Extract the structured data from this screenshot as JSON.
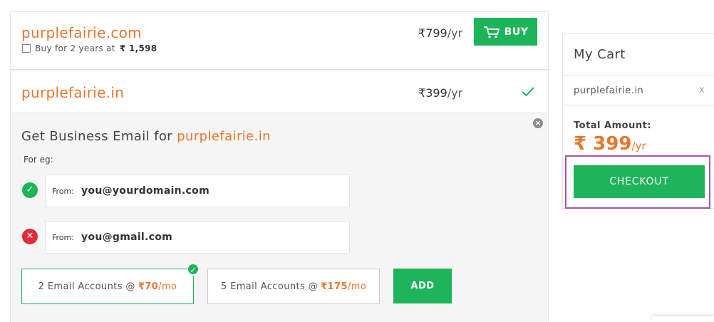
{
  "domains": [
    {
      "name": "purplefairie.com",
      "price_symbol": "₹",
      "price_value": "799",
      "price_unit": "/yr",
      "buy_label": "BUY",
      "option_text": "Buy for 2 years at",
      "option_price_symbol": "₹",
      "option_price": "1,598"
    },
    {
      "name": "purplefairie.in",
      "price_symbol": "₹",
      "price_value": "399",
      "price_unit": "/yr"
    }
  ],
  "business_email": {
    "title_prefix": "Get Business Email for",
    "title_domain": "purplefairie.in",
    "example_label": "For eg:",
    "examples": [
      {
        "from_label": "From:",
        "address": "you@yourdomain.com",
        "status": "valid"
      },
      {
        "from_label": "From:",
        "address": "you@gmail.com",
        "status": "invalid"
      }
    ],
    "plans": [
      {
        "text": "2 Email Accounts @",
        "symbol": "₹",
        "price": "70",
        "unit": "/mo",
        "selected": true
      },
      {
        "text": "5 Email Accounts @",
        "symbol": "₹",
        "price": "175",
        "unit": "/mo",
        "selected": false
      }
    ],
    "add_label": "ADD"
  },
  "cart": {
    "title": "My Cart",
    "items": [
      {
        "name": "purplefairie.in",
        "remove": "x"
      }
    ],
    "total_label": "Total Amount:",
    "total_symbol": "₹",
    "total_value": "399",
    "total_unit": "/yr",
    "checkout_label": "CHECKOUT"
  },
  "colors": {
    "accent_orange": "#e6772e",
    "green": "#1db45a",
    "red": "#e02b3d",
    "highlight_purple": "#a058b4"
  }
}
